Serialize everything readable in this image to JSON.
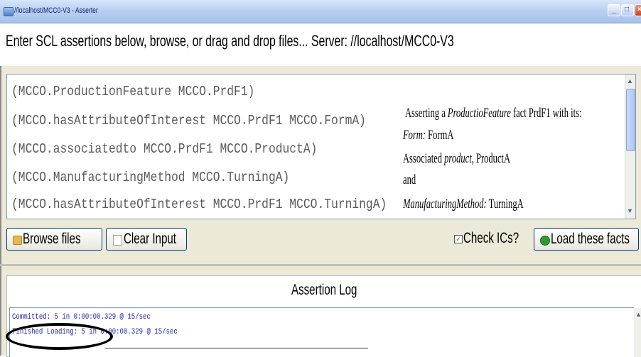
{
  "window": {
    "title": "//localhost/MCC0-V3 - Asserter",
    "controls": [
      "minimize",
      "maximize",
      "close"
    ]
  },
  "header": {
    "prompt": "Enter SCL assertions below, browse, or drag and drop files...  Server: //localhost/MCC0-V3"
  },
  "input": {
    "lines": [
      "(MCCO.ProductionFeature MCCO.PrdF1)",
      "(MCCO.hasAttributeOfInterest MCCO.PrdF1 MCCO.FormA)",
      "(MCCO.associatedto MCCO.PrdF1 MCCO.ProductA)",
      "(MCCO.ManufacturingMethod MCCO.TurningA)",
      "(MCCO.hasAttributeOfInterest MCCO.PrdF1 MCCO.TurningA)"
    ]
  },
  "annotation": {
    "line1_prefix": "Asserting a ",
    "line1_italic": "ProductioFeature",
    "line1_suffix": " fact PrdF1 with its:",
    "line2_italic": "Form:",
    "line2_suffix": " FormA",
    "line3_prefix": "Associated ",
    "line3_italic": "product,",
    "line3_suffix": " ProductA",
    "line4": "and",
    "line5_italic": "ManufacturingMethod:",
    "line5_suffix": " TurningA"
  },
  "toolbar": {
    "browse_label": "Browse files",
    "clear_label": "Clear Input",
    "check_label": "Check ICs?",
    "check_state": "checked",
    "load_label": "Load these facts"
  },
  "log": {
    "title": "Assertion Log",
    "lines": [
      "  Committed:  5 in 0:00:00.329 @ 15/sec",
      "Finished Loading: 5 in 0:00:00.329 @ 15/sec"
    ]
  },
  "colors": {
    "titlebar": "#b9d0f2",
    "log_text": "#1b23a8",
    "code_text": "#5a5a5a"
  }
}
